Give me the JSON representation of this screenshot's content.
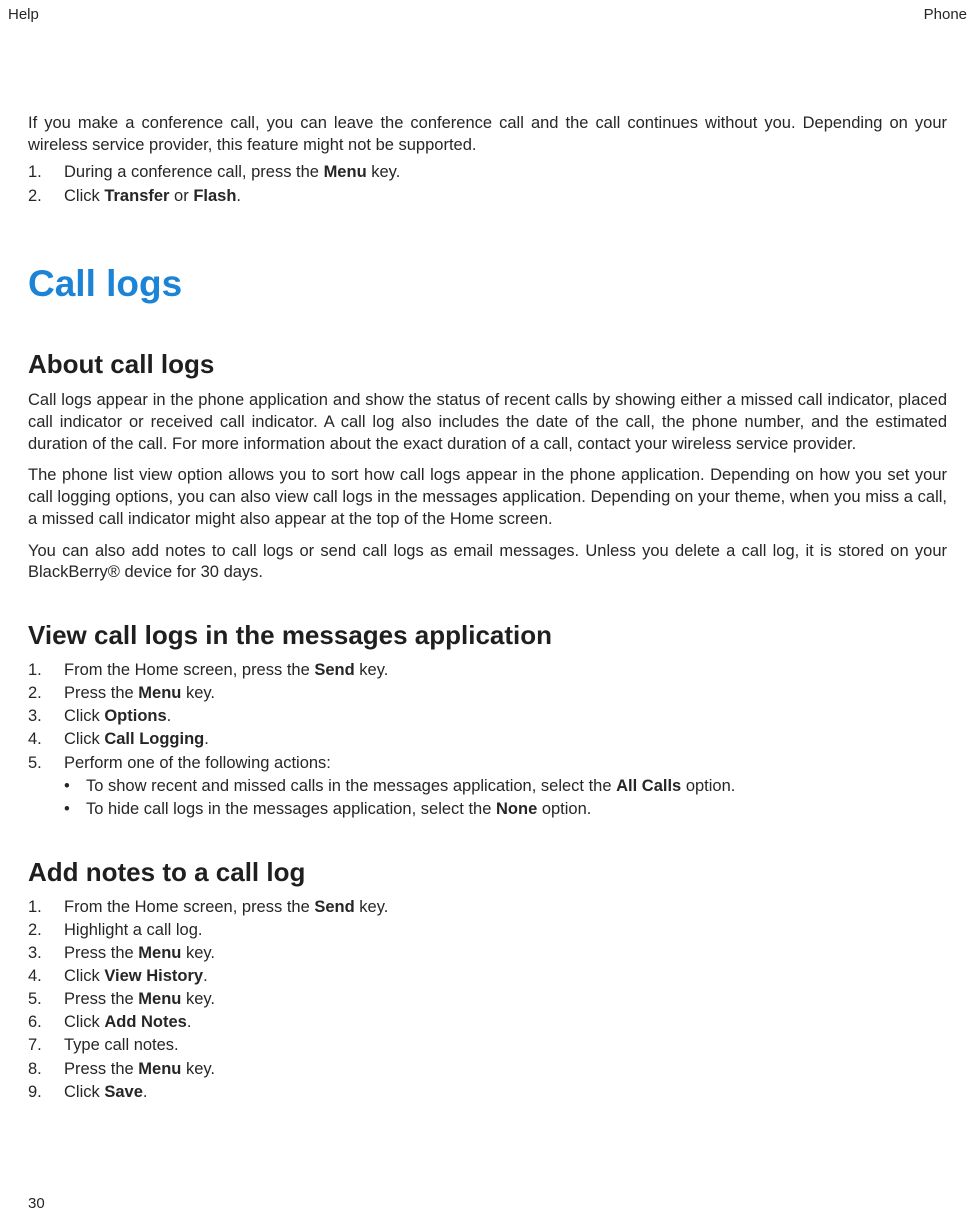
{
  "header": {
    "left": "Help",
    "right": "Phone"
  },
  "intro": {
    "text_a": "If you make a conference call, you can leave the conference call and the call continues without you. Depending on your wireless service provider, this feature might not be supported.",
    "step1_a": "During a conference call, press the ",
    "step1_b": "Menu",
    "step1_c": " key.",
    "step2_a": "Click ",
    "step2_b": "Transfer",
    "step2_c": " or ",
    "step2_d": "Flash",
    "step2_e": "."
  },
  "h1": "Call logs",
  "about": {
    "title": "About call logs",
    "p1": "Call logs appear in the phone application and show the status of recent calls by showing either a missed call indicator, placed call indicator or received call indicator. A call log also includes the date of the call, the phone number, and the estimated duration of the call. For more information about the exact duration of a call, contact your wireless service provider.",
    "p2": "The phone list view option allows you to sort how call logs appear in the phone application. Depending on how you set your call logging options, you can also view call logs in the messages application. Depending on your theme, when you miss a call, a missed call indicator might also appear at the top of the Home screen.",
    "p3": "You can also add notes to call logs or send call logs as email messages. Unless you delete a call log, it is stored on your BlackBerry® device for 30 days."
  },
  "view": {
    "title": "View call logs in the messages application",
    "s1a": "From the Home screen, press the ",
    "s1b": "Send",
    "s1c": " key.",
    "s2a": "Press the ",
    "s2b": "Menu",
    "s2c": " key.",
    "s3a": "Click ",
    "s3b": "Options",
    "s3c": ".",
    "s4a": "Click ",
    "s4b": "Call Logging",
    "s4c": ".",
    "s5": "Perform one of the following actions:",
    "b1a": "To show recent and missed calls in the messages application, select the ",
    "b1b": "All Calls",
    "b1c": " option.",
    "b2a": "To hide call logs in the messages application, select the ",
    "b2b": "None",
    "b2c": " option."
  },
  "notes": {
    "title": "Add notes to a call log",
    "s1a": "From the Home screen, press the ",
    "s1b": "Send",
    "s1c": " key.",
    "s2": "Highlight a call log.",
    "s3a": "Press the ",
    "s3b": "Menu",
    "s3c": " key.",
    "s4a": "Click ",
    "s4b": "View History",
    "s4c": ".",
    "s5a": "Press the ",
    "s5b": "Menu",
    "s5c": " key.",
    "s6a": "Click ",
    "s6b": "Add Notes",
    "s6c": ".",
    "s7": "Type call notes.",
    "s8a": "Press the ",
    "s8b": "Menu",
    "s8c": " key.",
    "s9a": "Click ",
    "s9b": "Save",
    "s9c": "."
  },
  "nums": {
    "n1": "1.",
    "n2": "2.",
    "n3": "3.",
    "n4": "4.",
    "n5": "5.",
    "n6": "6.",
    "n7": "7.",
    "n8": "8.",
    "n9": "9."
  },
  "bullet": "•",
  "page": "30"
}
